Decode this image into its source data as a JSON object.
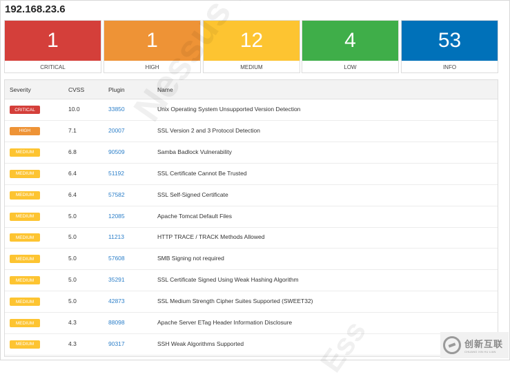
{
  "host": "192.168.23.6",
  "summary": [
    {
      "count": "1",
      "label": "CRITICAL",
      "color": "#d43f3a"
    },
    {
      "count": "1",
      "label": "HIGH",
      "color": "#ee9336"
    },
    {
      "count": "12",
      "label": "MEDIUM",
      "color": "#fdc431"
    },
    {
      "count": "4",
      "label": "LOW",
      "color": "#3fae49"
    },
    {
      "count": "53",
      "label": "INFO",
      "color": "#0071b9"
    }
  ],
  "table": {
    "headers": {
      "severity": "Severity",
      "cvss": "CVSS",
      "plugin": "Plugin",
      "name": "Name"
    },
    "rows": [
      {
        "severity": "CRITICAL",
        "color": "#d43f3a",
        "cvss": "10.0",
        "plugin": "33850",
        "name": "Unix Operating System Unsupported Version Detection"
      },
      {
        "severity": "HIGH",
        "color": "#ee9336",
        "cvss": "7.1",
        "plugin": "20007",
        "name": "SSL Version 2 and 3 Protocol Detection"
      },
      {
        "severity": "MEDIUM",
        "color": "#fdc431",
        "cvss": "6.8",
        "plugin": "90509",
        "name": "Samba Badlock Vulnerability"
      },
      {
        "severity": "MEDIUM",
        "color": "#fdc431",
        "cvss": "6.4",
        "plugin": "51192",
        "name": "SSL Certificate Cannot Be Trusted"
      },
      {
        "severity": "MEDIUM",
        "color": "#fdc431",
        "cvss": "6.4",
        "plugin": "57582",
        "name": "SSL Self-Signed Certificate"
      },
      {
        "severity": "MEDIUM",
        "color": "#fdc431",
        "cvss": "5.0",
        "plugin": "12085",
        "name": "Apache Tomcat Default Files"
      },
      {
        "severity": "MEDIUM",
        "color": "#fdc431",
        "cvss": "5.0",
        "plugin": "11213",
        "name": "HTTP TRACE / TRACK Methods Allowed"
      },
      {
        "severity": "MEDIUM",
        "color": "#fdc431",
        "cvss": "5.0",
        "plugin": "57608",
        "name": "SMB Signing not required"
      },
      {
        "severity": "MEDIUM",
        "color": "#fdc431",
        "cvss": "5.0",
        "plugin": "35291",
        "name": "SSL Certificate Signed Using Weak Hashing Algorithm"
      },
      {
        "severity": "MEDIUM",
        "color": "#fdc431",
        "cvss": "5.0",
        "plugin": "42873",
        "name": "SSL Medium Strength Cipher Suites Supported (SWEET32)"
      },
      {
        "severity": "MEDIUM",
        "color": "#fdc431",
        "cvss": "4.3",
        "plugin": "88098",
        "name": "Apache Server ETag Header Information Disclosure"
      },
      {
        "severity": "MEDIUM",
        "color": "#fdc431",
        "cvss": "4.3",
        "plugin": "90317",
        "name": "SSH Weak Algorithms Supported"
      }
    ]
  },
  "watermark": {
    "text": "Nessus Ess",
    "text2": "Ess"
  },
  "corner_logo": {
    "brand": "创新互联",
    "sub": "CHUANG XIN HU LIAN",
    "icon": "swirl-logo-icon"
  }
}
